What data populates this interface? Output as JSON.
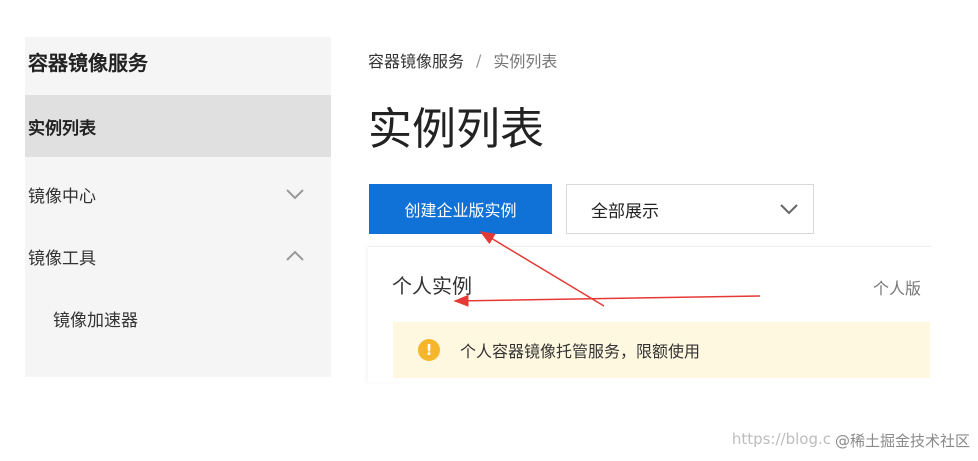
{
  "sidebar": {
    "title": "容器镜像服务",
    "items": [
      {
        "label": "实例列表",
        "active": true
      },
      {
        "label": "镜像中心",
        "icon": "chevron-down-icon"
      },
      {
        "label": "镜像工具",
        "icon": "chevron-up-icon"
      },
      {
        "label": "镜像加速器"
      }
    ]
  },
  "breadcrumb": {
    "root": "容器镜像服务",
    "separator": "/",
    "current": "实例列表"
  },
  "page": {
    "title": "实例列表"
  },
  "toolbar": {
    "create_button": "创建企业版实例",
    "filter_select": "全部展示"
  },
  "card": {
    "title": "个人实例",
    "edition_label": "个人版",
    "notice": "个人容器镜像托管服务，限额使用",
    "notice_icon": "warning-icon"
  },
  "watermark": {
    "url": "https://blog.c",
    "brand": "@稀土掘金技术社区"
  },
  "colors": {
    "primary": "#1072d6",
    "warning": "#f6b62b",
    "notice_bg": "#fff8e1",
    "annotation": "#e53935"
  }
}
